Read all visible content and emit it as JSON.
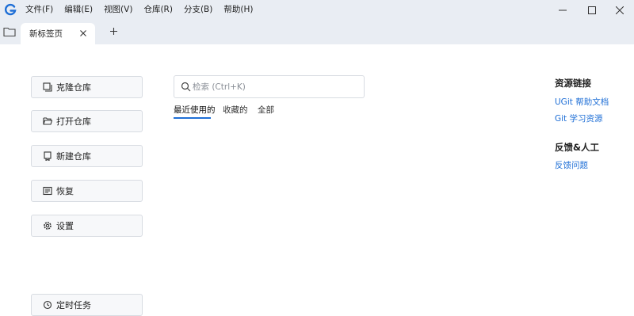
{
  "app": {
    "accent": "#1f6fd6",
    "logo_icon": "ugit-logo"
  },
  "menu": [
    "文件(F)",
    "编辑(E)",
    "视图(V)",
    "仓库(R)",
    "分支(B)",
    "帮助(H)"
  ],
  "window_controls": [
    "minimize-icon",
    "maximize-icon",
    "close-icon"
  ],
  "tabs": {
    "active_label": "新标签页",
    "close_icon": "close-icon",
    "new_tab_icon": "plus-icon"
  },
  "actions": [
    {
      "label": "克隆仓库",
      "icon": "clone-icon"
    },
    {
      "label": "打开仓库",
      "icon": "folder-open-icon"
    },
    {
      "label": "新建仓库",
      "icon": "new-repo-icon"
    },
    {
      "label": "恢复",
      "icon": "restore-icon"
    },
    {
      "label": "设置",
      "icon": "gear-icon"
    },
    {
      "label": "定时任务",
      "icon": "clock-icon"
    }
  ],
  "search": {
    "placeholder": "检索 (Ctrl+K)",
    "value": ""
  },
  "repo_tabs": [
    "最近使用的",
    "收藏的",
    "全部"
  ],
  "resources": {
    "title": "资源链接",
    "links": [
      "UGit 帮助文档",
      "Git 学习资源"
    ]
  },
  "feedback": {
    "title": "反馈&人工",
    "links": [
      "反馈问题"
    ]
  }
}
